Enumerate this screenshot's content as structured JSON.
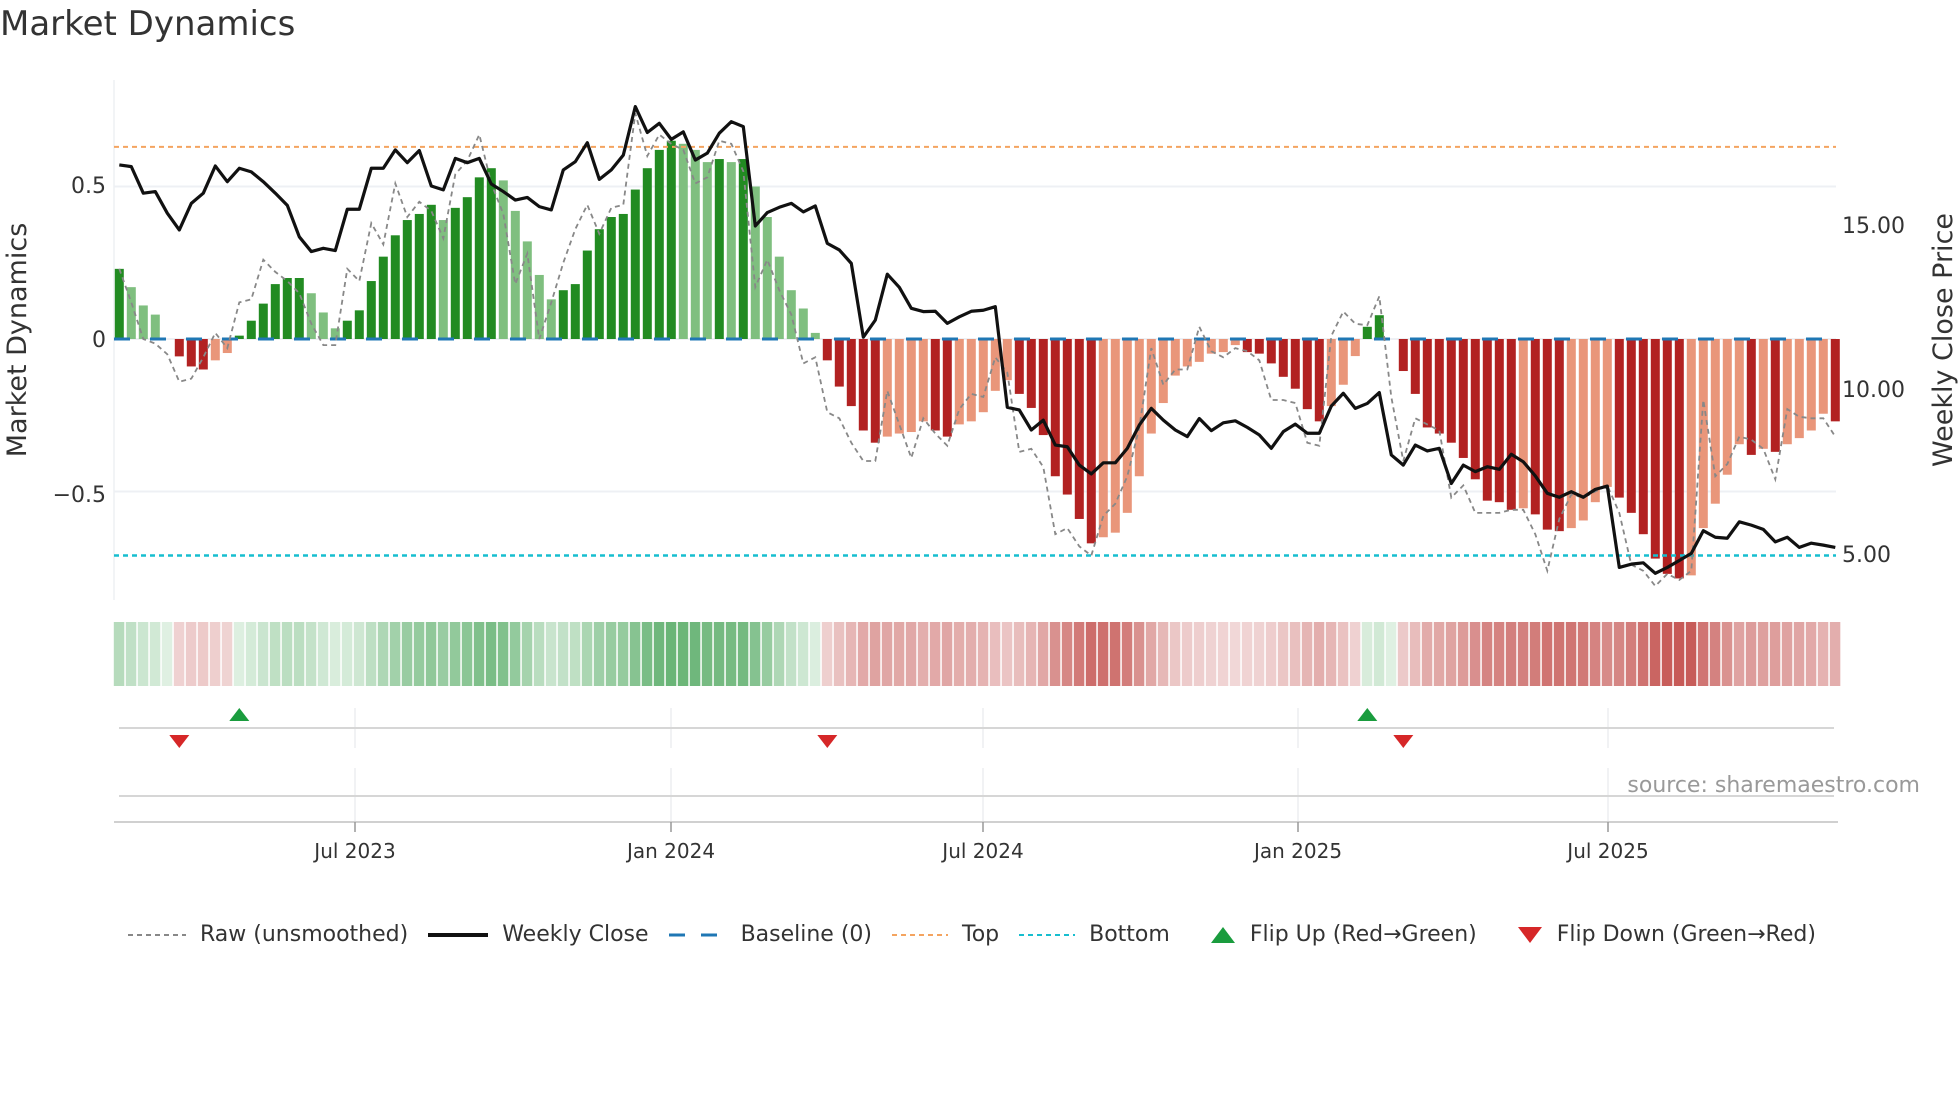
{
  "title": "Market Dynamics",
  "source": "source: sharemaestro.com",
  "colors": {
    "up_strong": "#228b22",
    "up_weak": "#7fbf7f",
    "down_strong": "#b22222",
    "down_weak": "#e9967a",
    "close": "#111111",
    "raw": "#888888",
    "baseline": "#1f77b4",
    "top": "#f4a460",
    "bottom": "#17becf",
    "flip_up": "#1a9c3e",
    "flip_down": "#d62728"
  },
  "legend": {
    "raw": "Raw (unsmoothed)",
    "close": "Weekly Close",
    "baseline": "Baseline (0)",
    "top": "Top",
    "bottom": "Bottom",
    "flip_up": "Flip Up (Red→Green)",
    "flip_down": "Flip Down (Green→Red)"
  },
  "chart_data": {
    "type": "bar",
    "title": "Market Dynamics",
    "ylabel": "Market Dynamics",
    "y2label": "Weekly Close Price",
    "x_start_date": "2023-02-13",
    "x_interval_days": 7,
    "ylim": [
      -0.82,
      0.78
    ],
    "y_ticks": [
      {
        "value": 0.5,
        "label": "0.5"
      },
      {
        "value": 0,
        "label": "0"
      },
      {
        "value": -0.5,
        "label": "−0.5"
      }
    ],
    "y2_ticks": [
      {
        "value": 15,
        "label": "15.00"
      },
      {
        "value": 10,
        "label": "10.00"
      },
      {
        "value": 5,
        "label": "5.00"
      }
    ],
    "x_ticks": [
      {
        "date": "2023-07-01",
        "label": "Jul 2023"
      },
      {
        "date": "2024-01-01",
        "label": "Jan 2024"
      },
      {
        "date": "2024-07-01",
        "label": "Jul 2024"
      },
      {
        "date": "2025-01-01",
        "label": "Jan 2025"
      },
      {
        "date": "2025-07-01",
        "label": "Jul 2025"
      }
    ],
    "top_level": 0.63,
    "bottom_level": -0.71,
    "baseline": 0,
    "smoothed": [
      0.23,
      0.17,
      0.11,
      0.08,
      0.0,
      -0.057,
      -0.09,
      -0.1,
      -0.07,
      -0.046,
      0.011,
      0.06,
      0.116,
      0.18,
      0.2,
      0.2,
      0.15,
      0.087,
      0.035,
      0.06,
      0.094,
      0.19,
      0.27,
      0.34,
      0.39,
      0.41,
      0.44,
      0.39,
      0.43,
      0.465,
      0.53,
      0.56,
      0.52,
      0.42,
      0.32,
      0.21,
      0.13,
      0.16,
      0.18,
      0.29,
      0.36,
      0.4,
      0.41,
      0.49,
      0.56,
      0.62,
      0.65,
      0.64,
      0.62,
      0.58,
      0.59,
      0.58,
      0.59,
      0.5,
      0.4,
      0.27,
      0.16,
      0.1,
      0.02,
      -0.07,
      -0.156,
      -0.22,
      -0.3,
      -0.34,
      -0.32,
      -0.31,
      -0.305,
      -0.27,
      -0.3,
      -0.32,
      -0.28,
      -0.27,
      -0.24,
      -0.17,
      -0.135,
      -0.18,
      -0.226,
      -0.315,
      -0.45,
      -0.51,
      -0.59,
      -0.67,
      -0.65,
      -0.635,
      -0.57,
      -0.45,
      -0.31,
      -0.21,
      -0.12,
      -0.09,
      -0.075,
      -0.048,
      -0.043,
      -0.02,
      -0.043,
      -0.048,
      -0.08,
      -0.124,
      -0.163,
      -0.23,
      -0.27,
      -0.22,
      -0.15,
      -0.056,
      0.04,
      0.078,
      0.0,
      -0.105,
      -0.18,
      -0.29,
      -0.31,
      -0.34,
      -0.39,
      -0.46,
      -0.53,
      -0.535,
      -0.56,
      -0.555,
      -0.575,
      -0.625,
      -0.63,
      -0.62,
      -0.595,
      -0.535,
      -0.485,
      -0.52,
      -0.57,
      -0.64,
      -0.72,
      -0.77,
      -0.785,
      -0.775,
      -0.62,
      -0.54,
      -0.445,
      -0.345,
      -0.38,
      -0.36,
      -0.37,
      -0.345,
      -0.325,
      -0.3,
      -0.245,
      -0.27
    ],
    "raw": [
      0.23,
      0.12,
      0.0,
      -0.015,
      -0.05,
      -0.14,
      -0.13,
      -0.06,
      0.02,
      -0.03,
      0.12,
      0.13,
      0.26,
      0.22,
      0.19,
      0.15,
      0.05,
      -0.02,
      -0.02,
      0.23,
      0.19,
      0.38,
      0.31,
      0.51,
      0.4,
      0.45,
      0.42,
      0.33,
      0.54,
      0.585,
      0.67,
      0.51,
      0.41,
      0.18,
      0.28,
      0.0,
      0.12,
      0.25,
      0.36,
      0.44,
      0.345,
      0.43,
      0.44,
      0.74,
      0.6,
      0.67,
      0.64,
      0.62,
      0.51,
      0.53,
      0.65,
      0.64,
      0.55,
      0.17,
      0.26,
      0.16,
      0.08,
      -0.08,
      -0.06,
      -0.24,
      -0.26,
      -0.34,
      -0.4,
      -0.4,
      -0.17,
      -0.28,
      -0.39,
      -0.26,
      -0.31,
      -0.35,
      -0.23,
      -0.18,
      -0.19,
      -0.06,
      -0.11,
      -0.37,
      -0.36,
      -0.42,
      -0.64,
      -0.62,
      -0.68,
      -0.71,
      -0.58,
      -0.54,
      -0.45,
      -0.29,
      -0.03,
      -0.15,
      -0.1,
      -0.1,
      0.04,
      -0.04,
      -0.06,
      -0.03,
      -0.04,
      -0.07,
      -0.2,
      -0.2,
      -0.21,
      -0.34,
      -0.35,
      0.01,
      0.09,
      0.05,
      0.045,
      0.14,
      -0.19,
      -0.4,
      -0.26,
      -0.28,
      -0.3,
      -0.52,
      -0.48,
      -0.57,
      -0.57,
      -0.57,
      -0.56,
      -0.56,
      -0.64,
      -0.76,
      -0.59,
      -0.51,
      -0.52,
      -0.5,
      -0.48,
      -0.57,
      -0.74,
      -0.76,
      -0.81,
      -0.77,
      -0.79,
      -0.76,
      -0.2,
      -0.45,
      -0.41,
      -0.32,
      -0.33,
      -0.36,
      -0.46,
      -0.23,
      -0.255,
      -0.26,
      -0.26,
      -0.32
    ],
    "weekly_close": [
      16.83,
      16.78,
      15.97,
      16.02,
      15.36,
      14.85,
      15.66,
      15.97,
      16.8,
      16.32,
      16.73,
      16.62,
      16.32,
      15.97,
      15.6,
      14.64,
      14.19,
      14.29,
      14.22,
      15.48,
      15.48,
      16.73,
      16.73,
      17.29,
      16.9,
      17.27,
      16.19,
      16.07,
      17.03,
      16.9,
      17.03,
      16.25,
      16.02,
      15.76,
      15.84,
      15.56,
      15.46,
      16.68,
      16.93,
      17.51,
      16.39,
      16.68,
      17.13,
      18.61,
      17.82,
      18.1,
      17.61,
      17.84,
      16.98,
      17.19,
      17.8,
      18.15,
      18.0,
      14.97,
      15.38,
      15.54,
      15.66,
      15.4,
      15.58,
      14.44,
      14.24,
      13.83,
      11.58,
      12.1,
      13.5,
      13.1,
      12.46,
      12.36,
      12.37,
      12.0,
      12.2,
      12.37,
      12.4,
      12.51,
      9.44,
      9.36,
      8.75,
      9.05,
      8.29,
      8.24,
      7.68,
      7.41,
      7.75,
      7.75,
      8.19,
      8.9,
      9.41,
      9.05,
      8.75,
      8.55,
      9.1,
      8.73,
      8.97,
      9.03,
      8.83,
      8.6,
      8.19,
      8.7,
      8.93,
      8.65,
      8.65,
      9.48,
      9.87,
      9.41,
      9.56,
      9.89,
      7.99,
      7.68,
      8.29,
      8.11,
      8.19,
      7.12,
      7.68,
      7.48,
      7.63,
      7.55,
      8.01,
      7.78,
      7.35,
      6.82,
      6.7,
      6.87,
      6.7,
      6.94,
      7.04,
      4.56,
      4.66,
      4.7,
      4.38,
      4.56,
      4.77,
      4.99,
      5.68,
      5.48,
      5.45,
      5.95,
      5.85,
      5.72,
      5.34,
      5.48,
      5.17,
      5.3,
      5.24,
      5.17
    ],
    "flips_up_week_index": [
      10,
      104
    ],
    "flips_down_week_index": [
      5,
      59,
      107
    ]
  }
}
